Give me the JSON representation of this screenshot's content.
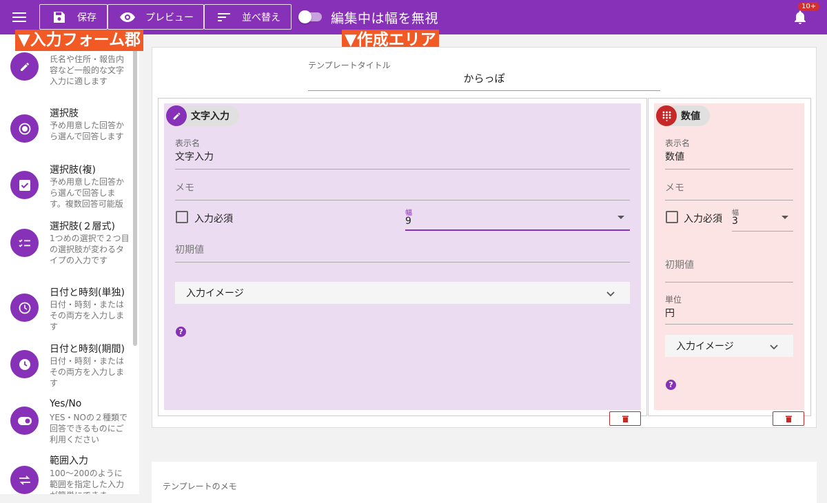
{
  "toolbar": {
    "save_label": "保存",
    "preview_label": "プレビュー",
    "sort_label": "並べ替え",
    "toggle_label": "編集中は幅を無視",
    "notification_count": "10+",
    "accent_color": "#8730b8"
  },
  "annotations": {
    "left": "▼入力フォーム郡",
    "right": "▼作成エリア"
  },
  "sidebar": {
    "items": [
      {
        "title": "",
        "desc": "氏名や住所・報告内容など一般的な文字入力に適します",
        "icon": "pencil-icon"
      },
      {
        "title": "選択肢",
        "desc": "予め用意した回答から選んで回答します",
        "icon": "radio-icon"
      },
      {
        "title": "選択肢(複)",
        "desc": "予め用意した回答から選んで回答します。複数回答可能版",
        "icon": "checkbox-icon"
      },
      {
        "title": "選択肢(２層式)",
        "desc": "1つめの選択で２つ目の選択肢が変わるタイプの入力です",
        "icon": "checklist-icon"
      },
      {
        "title": "日付と時刻(単独)",
        "desc": "日付・時刻・またはその両方を入力します",
        "icon": "clock-outline-icon"
      },
      {
        "title": "日付と時刻(期間)",
        "desc": "日付・時刻・またはその両方を入力します",
        "icon": "clock-filled-icon"
      },
      {
        "title": "Yes/No",
        "desc": "YES・NOの２種類で回答できるものにご利用ください",
        "icon": "toggle-icon"
      },
      {
        "title": "範囲入力",
        "desc": "100〜200のように範囲を指定した入力が簡単にできま",
        "icon": "swap-icon"
      }
    ]
  },
  "template": {
    "title_label": "テンプレートタイトル",
    "title_value": "からっぽ",
    "memo_label": "テンプレートのメモ"
  },
  "cards": [
    {
      "chip_label": "文字入力",
      "display_name_label": "表示名",
      "display_name_value": "文字入力",
      "memo_placeholder": "メモ",
      "required_label": "入力必須",
      "width_label": "幅",
      "width_value": "9",
      "default_placeholder": "初期値",
      "preview_label": "入力イメージ",
      "help": "?"
    },
    {
      "chip_label": "数値",
      "display_name_label": "表示名",
      "display_name_value": "数値",
      "memo_placeholder": "メモ",
      "required_label": "入力必須",
      "width_label": "幅",
      "width_value": "3",
      "default_placeholder": "初期値",
      "unit_label": "単位",
      "unit_value": "円",
      "preview_label": "入力イメージ",
      "help": "?"
    }
  ]
}
